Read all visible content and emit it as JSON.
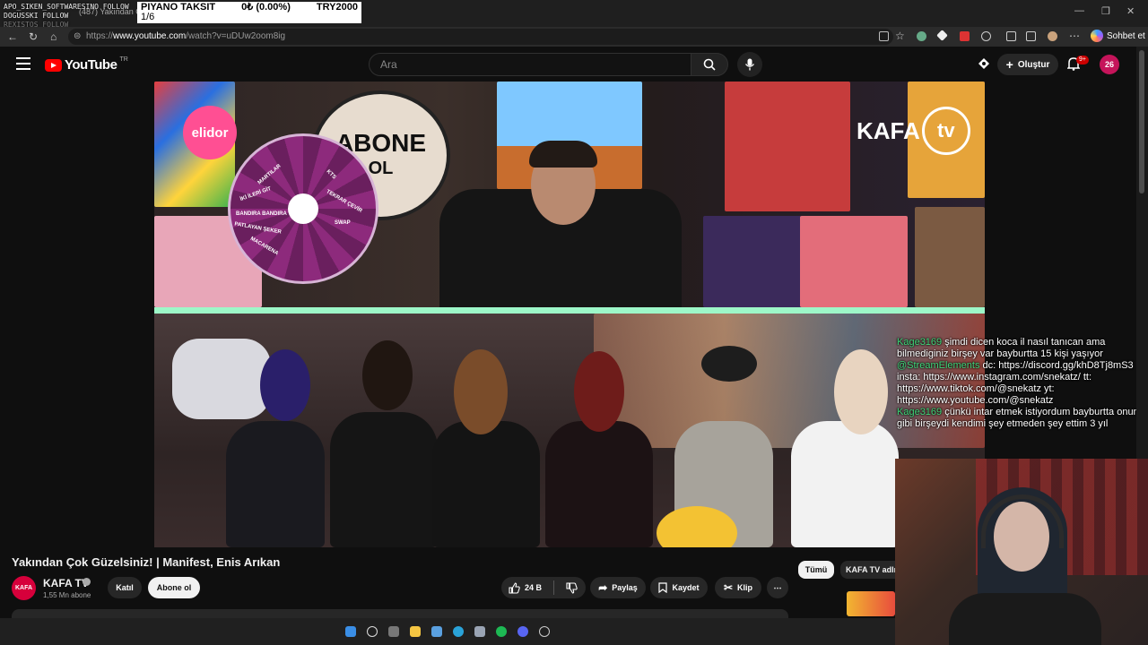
{
  "overlay": {
    "names": [
      "APO_SIKEN_SOFTWARESINO FOLLOW",
      "DOGUSSKI FOLLOW",
      "REXISTOS FOLLOW"
    ],
    "ticker": {
      "name": "PIYANO TAKSIT",
      "amount": "0₺ (0.00%)",
      "goal": "TRY2000",
      "page": "1/6"
    }
  },
  "browser": {
    "tab_title": "(487) Yakından Çok",
    "url_prefix": "https://",
    "url_host": "www.youtube.com",
    "url_path": "/watch?v=uDUw2oom8ig",
    "copilot_label": "Sohbet et",
    "window_controls": [
      "—",
      "❐",
      "✕"
    ]
  },
  "youtube": {
    "logo_text": "YouTube",
    "logo_region": "TR",
    "search_placeholder": "Ara",
    "create_label": "Oluştur",
    "notification_badge": "9+",
    "avatar_text": "26"
  },
  "video_scene": {
    "brand_badge": "elidor",
    "sign_line1": "ABONE",
    "sign_line2": "OL",
    "channel_logo_left": "KAFA",
    "channel_logo_right": "tv",
    "wheel_labels": [
      "MARTILAR",
      "İKİ İLERİ GİT",
      "BANDIRA BANDIRA",
      "MANİFEST KARAR VERSİN",
      "PATLAYAN ŞEKER",
      "MACARENA",
      "CHANEL",
      "İKİ GERİ GİT",
      "RAKIM",
      "ÇARŞI KARIŞTI",
      "SWAP",
      "TEKRAR ÇEVİR",
      "KTS",
      "ARYO"
    ]
  },
  "chat": [
    {
      "user": "Kage3169",
      "text": "şimdi dicen koca il nasıl tanıcan ama bilmediginiz birşey var bayburtta 15 kişi yaşıyor"
    },
    {
      "user": "@StreamElements",
      "text": "dc: https://discord.gg/khD8Tj8mS3 insta: https://www.instagram.com/snekatz/ tt: https://www.tiktok.com/@snekatz yt: https://www.youtube.com/@snekatz"
    },
    {
      "user": "Kage3169",
      "text": "çünkü intar etmek istiyordum bayburtta onun gibi birşeydi kendimi şey etmeden şey ettim 3 yıl"
    }
  ],
  "video_info": {
    "title": "Yakından Çok Güzelsiniz! | Manifest, Enis Arıkan",
    "channel_name": "KAFA TV",
    "channel_avatar_text": "KAFA",
    "subscribers": "1,55 Mn abone",
    "join_label": "Katıl",
    "subscribe_label": "Abone ol",
    "likes": "24 B",
    "share_label": "Paylaş",
    "save_label": "Kaydet",
    "clip_label": "Klip",
    "more_label": "⋯"
  },
  "recommendations": {
    "chips": [
      "Tümü",
      "KAFA TV adlı"
    ]
  }
}
